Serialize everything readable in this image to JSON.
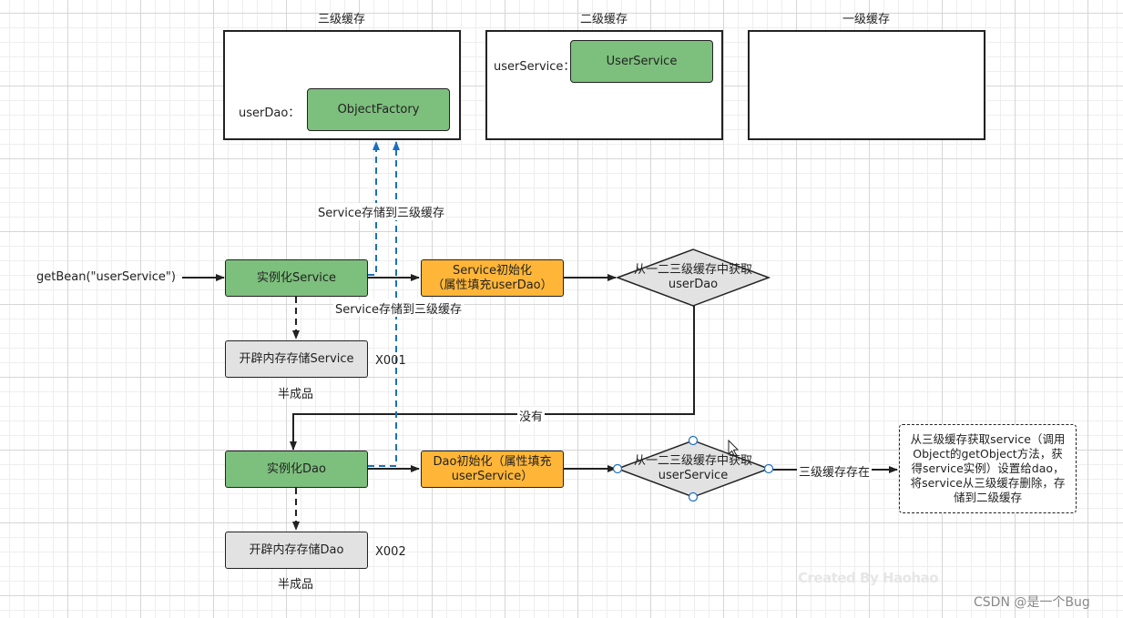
{
  "caches": {
    "third": {
      "title": "三级缓存",
      "entry_label": "userDao：",
      "entry_value": "ObjectFactory"
    },
    "second": {
      "title": "二级缓存",
      "entry_label": "userService：",
      "entry_value": "UserService"
    },
    "first": {
      "title": "一级缓存"
    }
  },
  "flow": {
    "start_label": "getBean(\"userService\")",
    "instantiate_service": "实例化Service",
    "alloc_service": "开辟内存存储Service",
    "service_addr": "X001",
    "service_half": "半成品",
    "service_init_line1": "Service初始化",
    "service_init_line2": "（属性填充userDao）",
    "diamond1_line1": "从一二三级缓存中获取",
    "diamond1_line2": "userDao",
    "store_label_top": "Service存储到三级缓存",
    "store_label_bottom": "Service存储到三级缓存",
    "not_found": "没有",
    "instantiate_dao": "实例化Dao",
    "alloc_dao": "开辟内存存储Dao",
    "dao_addr": "X002",
    "dao_half": "半成品",
    "dao_init_line1": "Dao初始化（属性填充",
    "dao_init_line2": "userService）",
    "diamond2_line1": "从一二三级缓存中获取",
    "diamond2_line2": "userService",
    "exists_label": "三级缓存存在",
    "note_lines": [
      "从三级缓存获取service（调用",
      "Object的getObject方法，获",
      "得service实例）设置给dao，",
      "将service从三级缓存删除，存",
      "储到二级缓存"
    ]
  },
  "watermarks": {
    "created_by": "Created By Haohao",
    "csdn": "CSDN @是一个Bug"
  },
  "colors": {
    "green": "#7dbf7d",
    "orange": "#ffb638",
    "gray": "#e2e2e2",
    "dashed_arrow": "#1a6fc0"
  }
}
